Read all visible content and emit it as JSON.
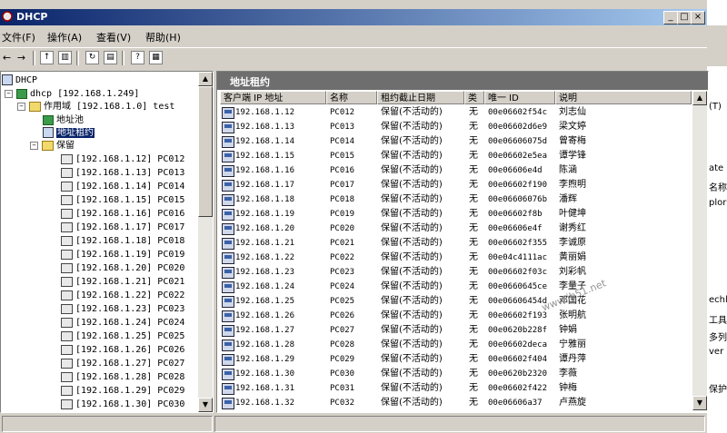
{
  "window": {
    "title": "DHCP"
  },
  "menu": [
    "文件(F)",
    "操作(A)",
    "查看(V)",
    "帮助(H)"
  ],
  "title_buttons": [
    "_",
    "□",
    "×"
  ],
  "tree": {
    "root": "DHCP",
    "server": "dhcp [192.168.1.249]",
    "scope": "作用域 [192.168.1.0] test",
    "pool": "地址池",
    "leases": "地址租约",
    "reserved": "保留",
    "reservations": [
      "[192.168.1.12] PC012",
      "[192.168.1.13] PC013",
      "[192.168.1.14] PC014",
      "[192.168.1.15] PC015",
      "[192.168.1.16] PC016",
      "[192.168.1.17] PC017",
      "[192.168.1.18] PC018",
      "[192.168.1.19] PC019",
      "[192.168.1.20] PC020",
      "[192.168.1.21] PC021",
      "[192.168.1.22] PC022",
      "[192.168.1.23] PC023",
      "[192.168.1.24] PC024",
      "[192.168.1.25] PC025",
      "[192.168.1.26] PC026",
      "[192.168.1.27] PC027",
      "[192.168.1.28] PC028",
      "[192.168.1.29] PC029",
      "[192.168.1.30] PC030"
    ]
  },
  "right": {
    "title": "地址租约",
    "columns": [
      "客户端 IP 地址",
      "名称",
      "租约截止日期",
      "类",
      "唯一 ID",
      "说明"
    ],
    "rows": [
      [
        "192.168.1.12",
        "PC012",
        "保留(不活动的)",
        "无",
        "00e06602f54c",
        "刘志仙"
      ],
      [
        "192.168.1.13",
        "PC013",
        "保留(不活动的)",
        "无",
        "00e06602d6e9",
        "梁文婷"
      ],
      [
        "192.168.1.14",
        "PC014",
        "保留(不活动的)",
        "无",
        "00e06606075d",
        "曾寄梅"
      ],
      [
        "192.168.1.15",
        "PC015",
        "保留(不活动的)",
        "无",
        "00e06602e5ea",
        "谭学锋"
      ],
      [
        "192.168.1.16",
        "PC016",
        "保留(不活动的)",
        "无",
        "00e06606e4d",
        "陈涵"
      ],
      [
        "192.168.1.17",
        "PC017",
        "保留(不活动的)",
        "无",
        "00e06602f190",
        "李煦明"
      ],
      [
        "192.168.1.18",
        "PC018",
        "保留(不活动的)",
        "无",
        "00e06606076b",
        "潘辉"
      ],
      [
        "192.168.1.19",
        "PC019",
        "保留(不活动的)",
        "无",
        "00e06602f8b",
        "叶健坤"
      ],
      [
        "192.168.1.20",
        "PC020",
        "保留(不活动的)",
        "无",
        "00e06606e4f",
        "谢秀红"
      ],
      [
        "192.168.1.21",
        "PC021",
        "保留(不活动的)",
        "无",
        "00e06602f355",
        "李诚原"
      ],
      [
        "192.168.1.22",
        "PC022",
        "保留(不活动的)",
        "无",
        "00e04c4111ac",
        "黄丽娟"
      ],
      [
        "192.168.1.23",
        "PC023",
        "保留(不活动的)",
        "无",
        "00e06602f03c",
        "刘彩帆"
      ],
      [
        "192.168.1.24",
        "PC024",
        "保留(不活动的)",
        "无",
        "00e0660645ce",
        "李量子"
      ],
      [
        "192.168.1.25",
        "PC025",
        "保留(不活动的)",
        "无",
        "00e06606454d",
        "邓国花"
      ],
      [
        "192.168.1.26",
        "PC026",
        "保留(不活动的)",
        "无",
        "00e06602f193",
        "张明航"
      ],
      [
        "192.168.1.27",
        "PC027",
        "保留(不活动的)",
        "无",
        "00e0620b228f",
        "钟娟"
      ],
      [
        "192.168.1.28",
        "PC028",
        "保留(不活动的)",
        "无",
        "00e06602deca",
        "宁雅丽"
      ],
      [
        "192.168.1.29",
        "PC029",
        "保留(不活动的)",
        "无",
        "00e06602f404",
        "谭丹萍"
      ],
      [
        "192.168.1.30",
        "PC030",
        "保留(不活动的)",
        "无",
        "00e0620b2320",
        "李薇"
      ],
      [
        "192.168.1.31",
        "PC031",
        "保留(不活动的)",
        "无",
        "00e06602f422",
        "钟梅"
      ],
      [
        "192.168.1.32",
        "PC032",
        "保留(不活动的)",
        "无",
        "00e06606a37",
        "卢燕旋"
      ]
    ]
  },
  "watermark": "www.jb51.net",
  "bg_fragments": [
    "(T)",
    "ate",
    "名称",
    "plor",
    "echl",
    "工具",
    "多列",
    "ver",
    "保护"
  ]
}
